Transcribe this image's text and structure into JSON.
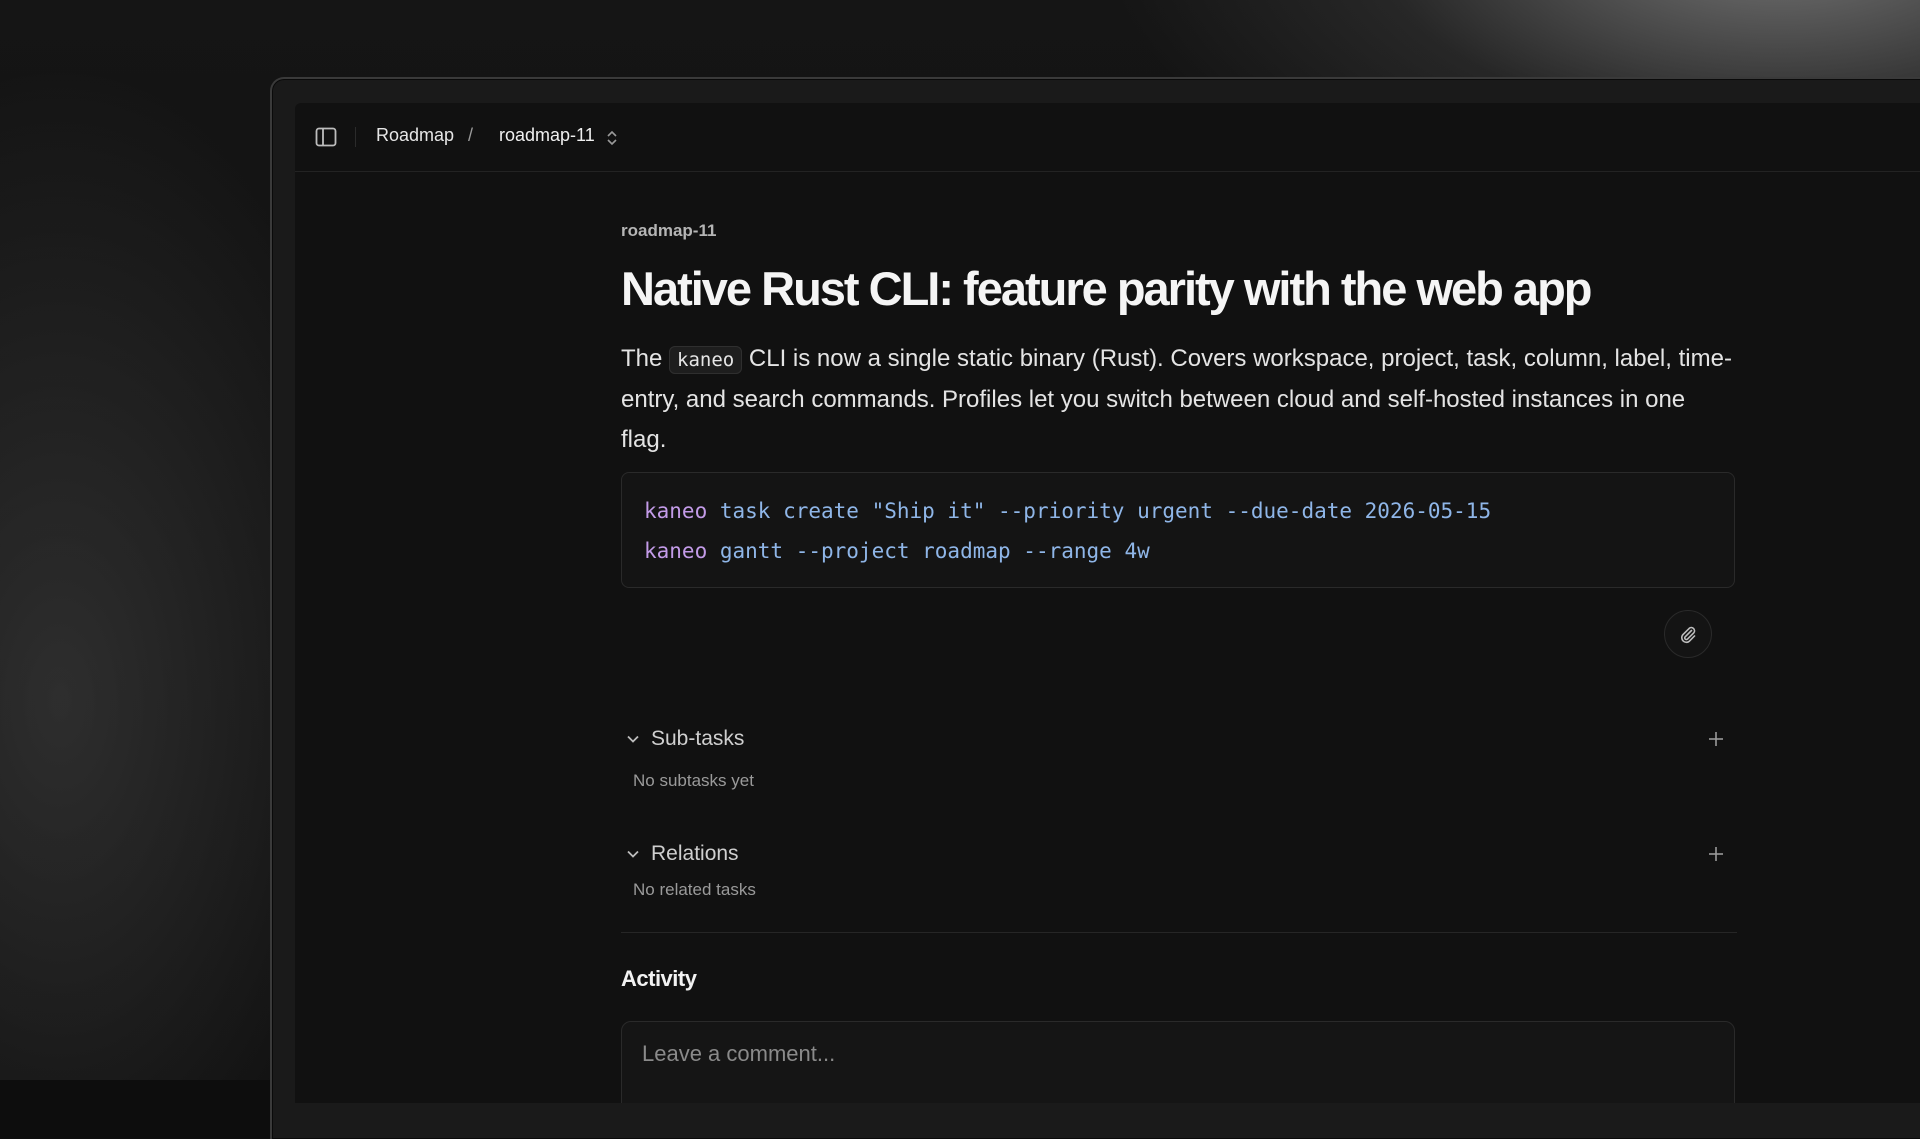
{
  "breadcrumb": {
    "root": "Roadmap",
    "separator": "/",
    "current": "roadmap-11"
  },
  "task": {
    "id": "roadmap-11",
    "title": "Native Rust CLI: feature parity with the web app",
    "description": {
      "before_code": "The ",
      "code": "kaneo",
      "after_code": " CLI is now a single static binary (Rust). Covers workspace, project, task, column, label, time-entry, and search commands. Profiles let you switch between cloud and self-hosted instances in one flag."
    },
    "code_lines": [
      {
        "cmd": "kaneo",
        "args": " task create \"Ship it\" --priority urgent --due-date 2026-05-15"
      },
      {
        "cmd": "kaneo",
        "args": " gantt --project roadmap --range 4w"
      }
    ]
  },
  "subtasks": {
    "label": "Sub-tasks",
    "empty": "No subtasks yet"
  },
  "relations": {
    "label": "Relations",
    "empty": "No related tasks"
  },
  "activity": {
    "title": "Activity",
    "comment_placeholder": "Leave a comment..."
  },
  "colors": {
    "command": "#c39be8",
    "argument": "#8fb6e8",
    "background": "#111111"
  }
}
